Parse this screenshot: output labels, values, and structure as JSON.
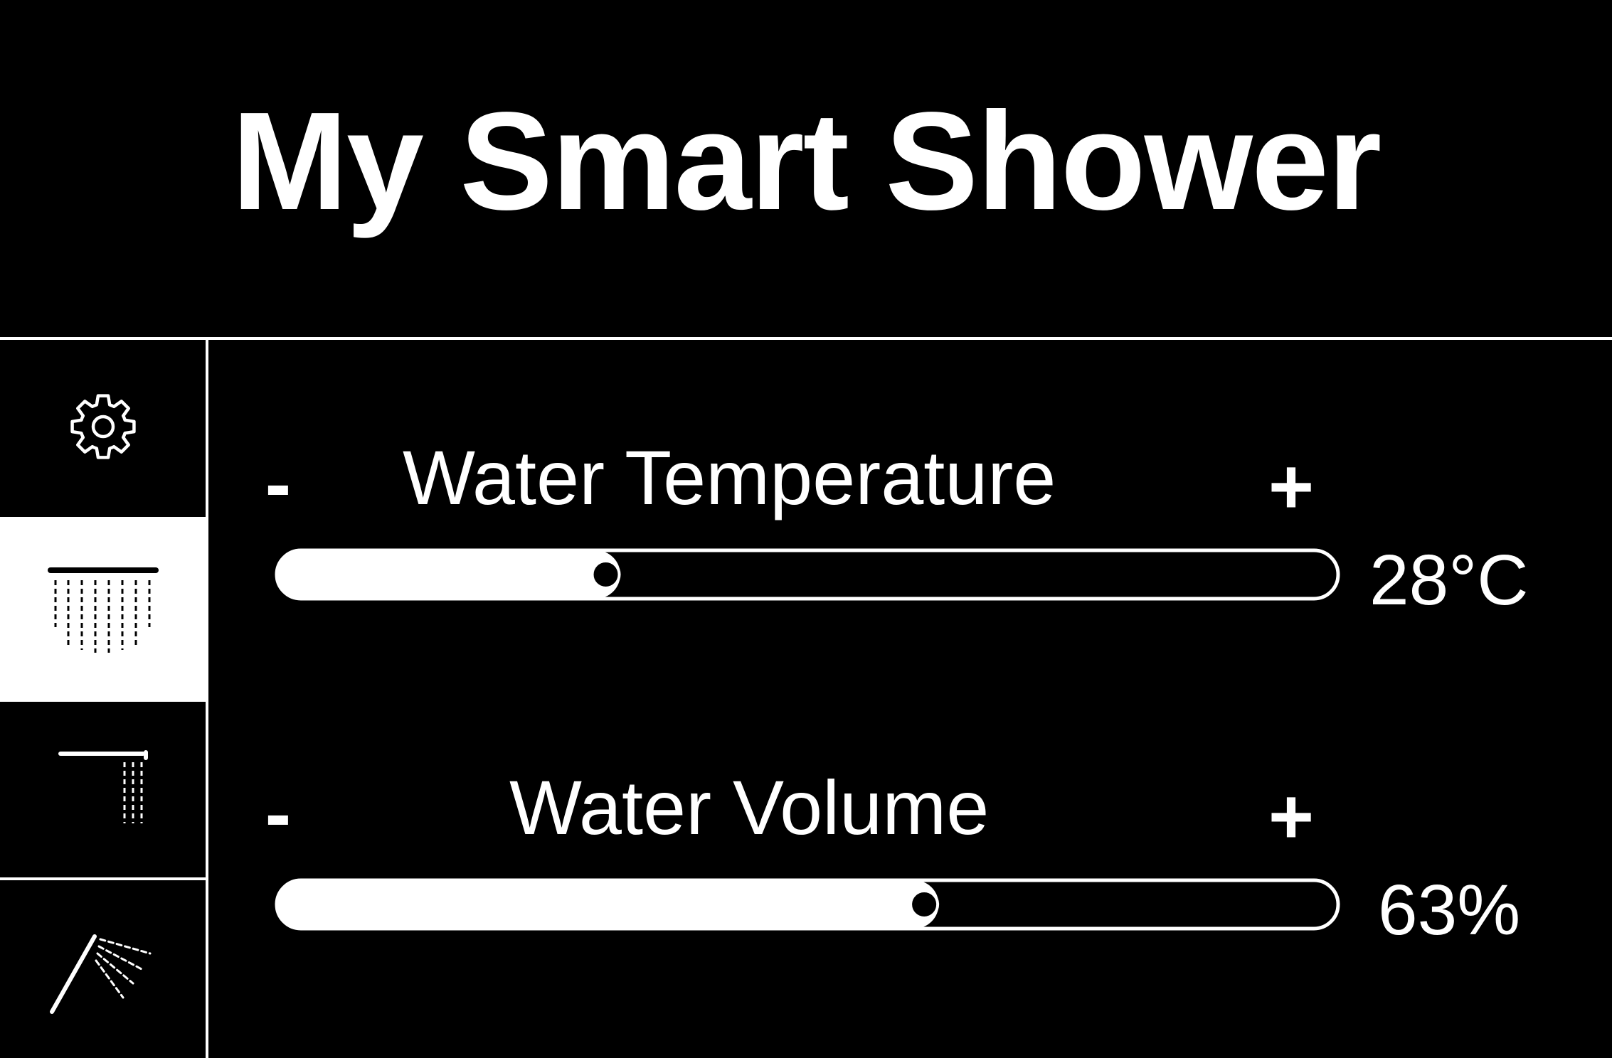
{
  "app": {
    "title": "My Smart Shower"
  },
  "sidebar": {
    "items": [
      {
        "icon": "gear-icon",
        "active": false
      },
      {
        "icon": "rain-shower-icon",
        "active": true
      },
      {
        "icon": "wall-shower-icon",
        "active": false
      },
      {
        "icon": "hand-shower-icon",
        "active": false
      }
    ]
  },
  "controls": {
    "temperature": {
      "label": "Water Temperature",
      "decrease": "-",
      "increase": "+",
      "value_text": "28°C",
      "level": 0.31
    },
    "volume": {
      "label": "Water Volume",
      "decrease": "-",
      "increase": "+",
      "value_text": "63%",
      "level": 0.61
    }
  },
  "colors": {
    "background": "#000000",
    "foreground": "#ffffff"
  }
}
